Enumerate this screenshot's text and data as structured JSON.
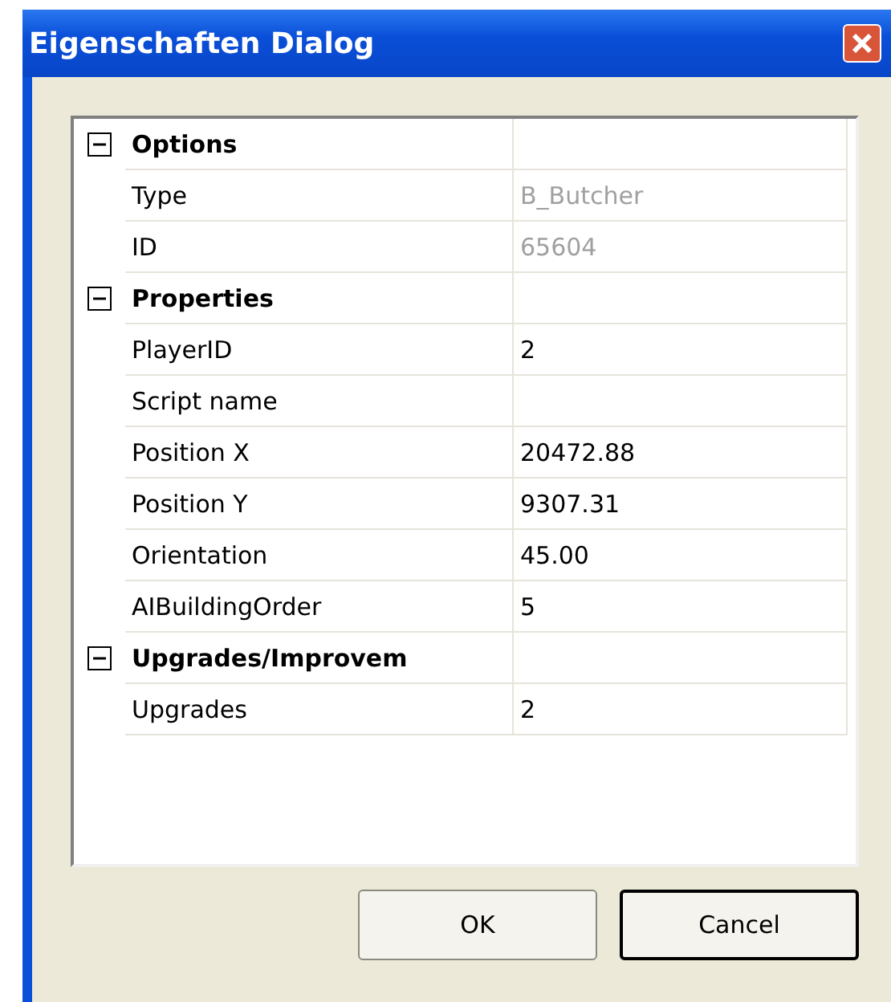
{
  "window": {
    "title": "Eigenschaften Dialog"
  },
  "groups": [
    {
      "label": "Options",
      "expanded": true,
      "rows": [
        {
          "name": "Type",
          "value": "B_Butcher",
          "disabled": true
        },
        {
          "name": "ID",
          "value": "65604",
          "disabled": true
        }
      ]
    },
    {
      "label": "Properties",
      "expanded": true,
      "rows": [
        {
          "name": "PlayerID",
          "value": "2",
          "disabled": false
        },
        {
          "name": "Script name",
          "disabled": false
        },
        {
          "name": "Position X",
          "value": "20472.88",
          "disabled": false
        },
        {
          "name": "Position Y",
          "value": "9307.31",
          "disabled": false
        },
        {
          "name": "Orientation",
          "value": "45.00",
          "disabled": false
        },
        {
          "name": "AIBuildingOrder",
          "value": "5",
          "disabled": false
        }
      ]
    },
    {
      "label": "Upgrades/Improvem",
      "expanded": true,
      "rows": [
        {
          "name": "Upgrades",
          "value": "2",
          "disabled": false
        }
      ]
    }
  ],
  "buttons": [
    {
      "label": "OK",
      "default": false
    },
    {
      "label": "Cancel",
      "default": true
    }
  ]
}
